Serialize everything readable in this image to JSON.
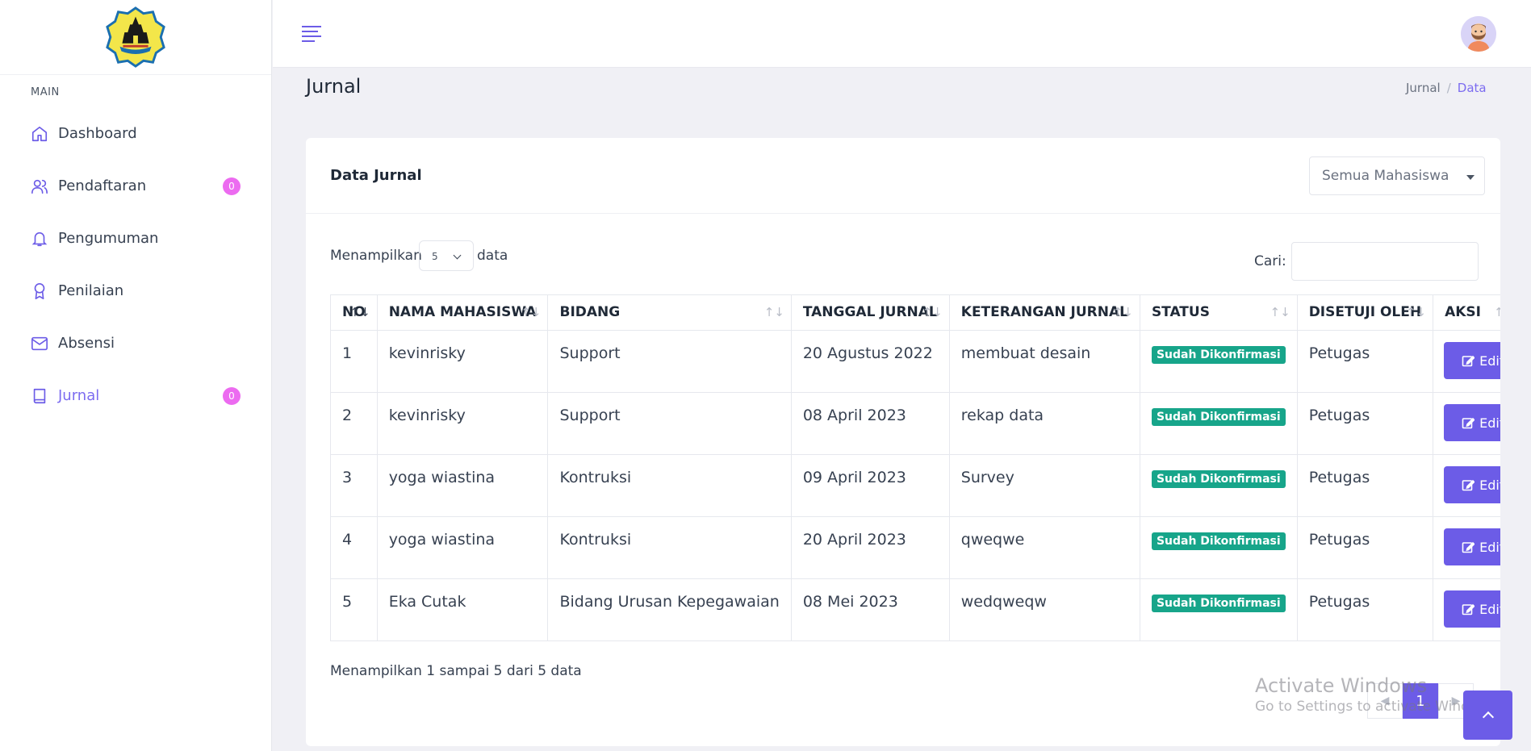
{
  "brand": {
    "logo_icon": "university-crest-logo"
  },
  "sidebar": {
    "heading": "MAIN",
    "items": [
      {
        "label": "Dashboard",
        "icon": "home-icon",
        "badge": null,
        "active": false
      },
      {
        "label": "Pendaftaran",
        "icon": "users-icon",
        "badge": "0",
        "active": false
      },
      {
        "label": "Pengumuman",
        "icon": "bell-icon",
        "badge": null,
        "active": false
      },
      {
        "label": "Penilaian",
        "icon": "award-icon",
        "badge": null,
        "active": false
      },
      {
        "label": "Absensi",
        "icon": "mail-icon",
        "badge": null,
        "active": false
      },
      {
        "label": "Jurnal",
        "icon": "book-icon",
        "badge": "0",
        "active": true
      }
    ]
  },
  "topbar": {
    "menu_icon": "hamburger-icon",
    "avatar_icon": "user-avatar"
  },
  "page": {
    "title": "Jurnal",
    "breadcrumb": [
      "Jurnal",
      "Data"
    ]
  },
  "card": {
    "title": "Data Jurnal",
    "filter": {
      "selected": "Semua Mahasiswa"
    },
    "length": {
      "prefix": "Menampilkan",
      "value": "5",
      "suffix": "data"
    },
    "search": {
      "label": "Cari:",
      "value": ""
    },
    "table": {
      "columns": [
        "NO",
        "NAMA MAHASISWA",
        "BIDANG",
        "TANGGAL JURNAL",
        "KETERANGAN JURNAL",
        "STATUS",
        "DISETUJI OLEH",
        "AKSI"
      ],
      "rows": [
        {
          "no": "1",
          "nama": "kevinrisky",
          "bidang": "Support",
          "tanggal": "20 Agustus 2022",
          "keterangan": "membuat desain",
          "status": "Sudah Dikonfirmasi",
          "disetujui": "Petugas",
          "aksi": "Edit"
        },
        {
          "no": "2",
          "nama": "kevinrisky",
          "bidang": "Support",
          "tanggal": "08 April 2023",
          "keterangan": "rekap data",
          "status": "Sudah Dikonfirmasi",
          "disetujui": "Petugas",
          "aksi": "Edit"
        },
        {
          "no": "3",
          "nama": "yoga wiastina",
          "bidang": "Kontruksi",
          "tanggal": "09 April 2023",
          "keterangan": "Survey",
          "status": "Sudah Dikonfirmasi",
          "disetujui": "Petugas",
          "aksi": "Edit"
        },
        {
          "no": "4",
          "nama": "yoga wiastina",
          "bidang": "Kontruksi",
          "tanggal": "20 April 2023",
          "keterangan": "qweqwe",
          "status": "Sudah Dikonfirmasi",
          "disetujui": "Petugas",
          "aksi": "Edit"
        },
        {
          "no": "5",
          "nama": "Eka Cutak",
          "bidang": "Bidang Urusan Kepegawaian",
          "tanggal": "08 Mei 2023",
          "keterangan": "wedqweqw",
          "status": "Sudah Dikonfirmasi",
          "disetujui": "Petugas",
          "aksi": "Edit"
        }
      ]
    },
    "info": "Menampilkan 1 sampai 5 dari 5 data",
    "pagination": {
      "current": "1"
    }
  },
  "watermark": {
    "title": "Activate Windows",
    "subtitle": "Go to Settings to activate Windows."
  },
  "colors": {
    "accent": "#6c5ce7",
    "active_text": "#7c6cf0",
    "badge": "#ec6bf0",
    "status_success": "#17a58a"
  }
}
